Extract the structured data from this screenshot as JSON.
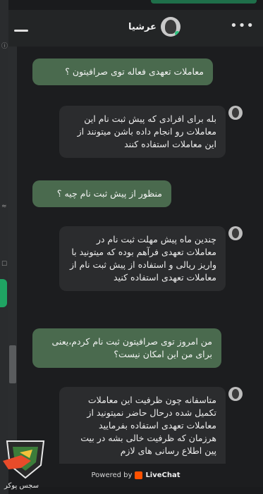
{
  "header": {
    "agent_name": "عرشیا",
    "minimize_label": "minimize",
    "more_label": "•••"
  },
  "messages": [
    {
      "from": "visitor",
      "text": "معاملات تعهدی فعاله توی صرافیتون ؟"
    },
    {
      "from": "agent",
      "text": "بله برای افرادی که پیش ثبت نام این معاملات رو انجام داده باشن میتونند از این معاملات استفاده کنند"
    },
    {
      "from": "visitor",
      "text": "منظور از پیش ثبت نام چیه ؟"
    },
    {
      "from": "agent",
      "text": "چندین ماه پیش مهلت ثبت نام در معاملات تعهدی فرآهم بوده که میتونید با واریز ریالی و استفاده از پیش ثبت نام از معاملات تعهدی استفاده کنید"
    },
    {
      "from": "visitor",
      "text": "من امروز توی صرافیتون ثبت نام کردم،یعنی برای من این امکان نیست؟"
    },
    {
      "from": "agent",
      "text": "متاسفانه چون ظرفیت این معاملات تکمیل شده درحال حاضر نمیتونید از معاملات تعهدی استفاده بفرمایید هرزمان که ظرفیت خالی بشه در بیت پین اطلاع رسانی های لازم"
    }
  ],
  "footer": {
    "powered_by": "Powered by",
    "brand": "LiveChat"
  },
  "brand_caption": "سجس پوکر",
  "colors": {
    "visitor_bubble": "#4a6a4e",
    "agent_bubble": "#2b2c2e",
    "livechat_orange": "#ff5100",
    "online": "#2ec27e"
  }
}
